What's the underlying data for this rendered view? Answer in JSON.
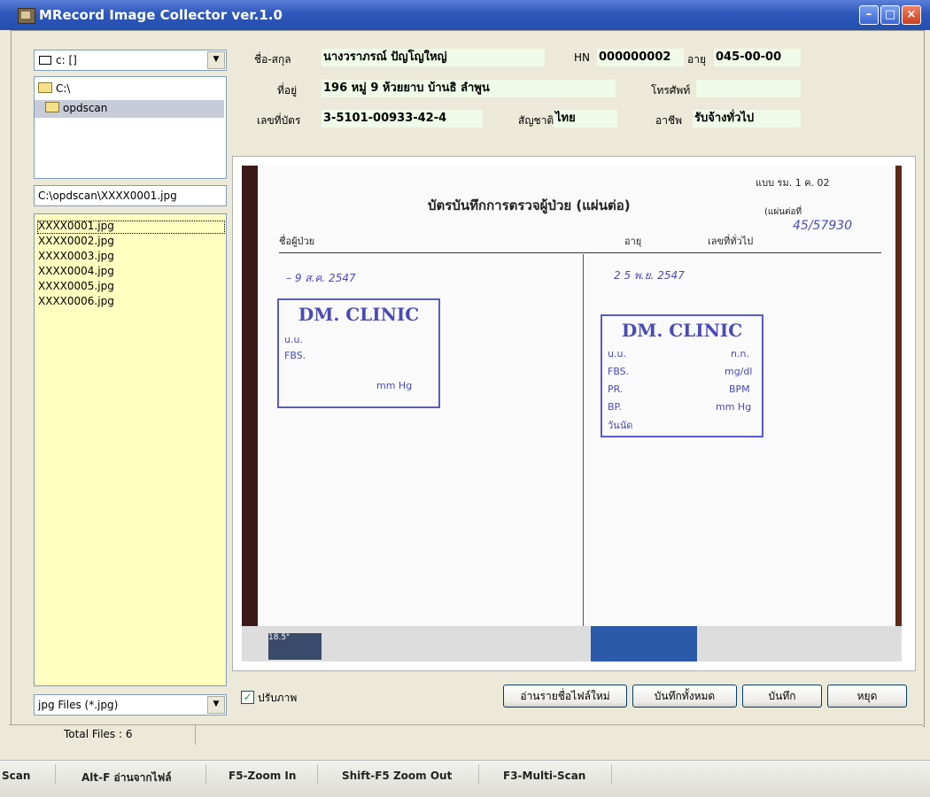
{
  "window": {
    "title": "MRecord Image Collector ver.1.0",
    "controls": {
      "minimize": "–",
      "maximize": "□",
      "close": "×"
    }
  },
  "left_panel": {
    "drive": "c: []",
    "folders": [
      "C:\\",
      "opdscan"
    ],
    "selected_folder": "opdscan",
    "path": "C:\\opdscan\\XXXX0001.jpg",
    "files": [
      "XXXX0001.jpg",
      "XXXX0002.jpg",
      "XXXX0003.jpg",
      "XXXX0004.jpg",
      "XXXX0005.jpg",
      "XXXX0006.jpg"
    ],
    "selected_file": "XXXX0001.jpg",
    "filter": "jpg Files (*.jpg)"
  },
  "patient": {
    "name_label": "ชื่อ-สกุล",
    "name": "นางวราภรณ์ ปัญโญใหญ่",
    "hn_label": "HN",
    "hn": "000000002",
    "age_label": "อายุ",
    "age": "045-00-00",
    "address_label": "ที่อยู่",
    "address": "196 หมู่ 9 ห้วยยาบ บ้านธิ ลำพูน",
    "phone_label": "โทรศัพท์",
    "phone": "",
    "id_label": "เลขที่บัตร",
    "id": "3-5101-00933-42-4",
    "nationality_label": "สัญชาติ",
    "nationality": "ไทย",
    "occupation_label": "อาชีพ",
    "occupation": "รับจ้างทั่วไป"
  },
  "scan": {
    "form_code": "แบบ รม. 1 ค. 02",
    "heading": "บัตรบันทึกการตรวจผู้ป่วย (แผ่นต่อ)",
    "sheet_no": "(แผ่นต่อที่",
    "patient_label": "ชื่อผู้ป่วย",
    "age_label": "อายุ",
    "general_no_label": "เลขที่ทั่วไป",
    "general_no": "45/57930",
    "date_left": "– 9 ส.ค. 2547",
    "date_right": "2 5 พ.ย. 2547",
    "stamp_title": "DM. CLINIC",
    "stamp_rows": [
      "u.u.",
      "FBS.",
      "PR.",
      "BP.",
      "วันนัด"
    ],
    "stamp_units": [
      "n.n.",
      "mg/dl",
      "BPM",
      "mm Hg"
    ],
    "monitor_label": "18.5\""
  },
  "buttons": {
    "adjust_label": "ปรับภาพ",
    "adjust_checked": true,
    "reload": "อ่านรายชื่อไฟล์ใหม่",
    "save_all": "บันทึกทั้งหมด",
    "save": "บันทึก",
    "stop": "หยุด"
  },
  "status": {
    "total_files": "Total Files : 6"
  },
  "hotkeys": [
    "Scan",
    "Alt-F อ่านจากไฟล์",
    "F5-Zoom In",
    "Shift-F5 Zoom Out",
    "F3-Multi-Scan"
  ],
  "colors": {
    "titlebar": "#2e57b9",
    "file_list_bg": "#ffffc0",
    "field_bg": "#f0fae8",
    "stamp": "#4a4ab8"
  }
}
